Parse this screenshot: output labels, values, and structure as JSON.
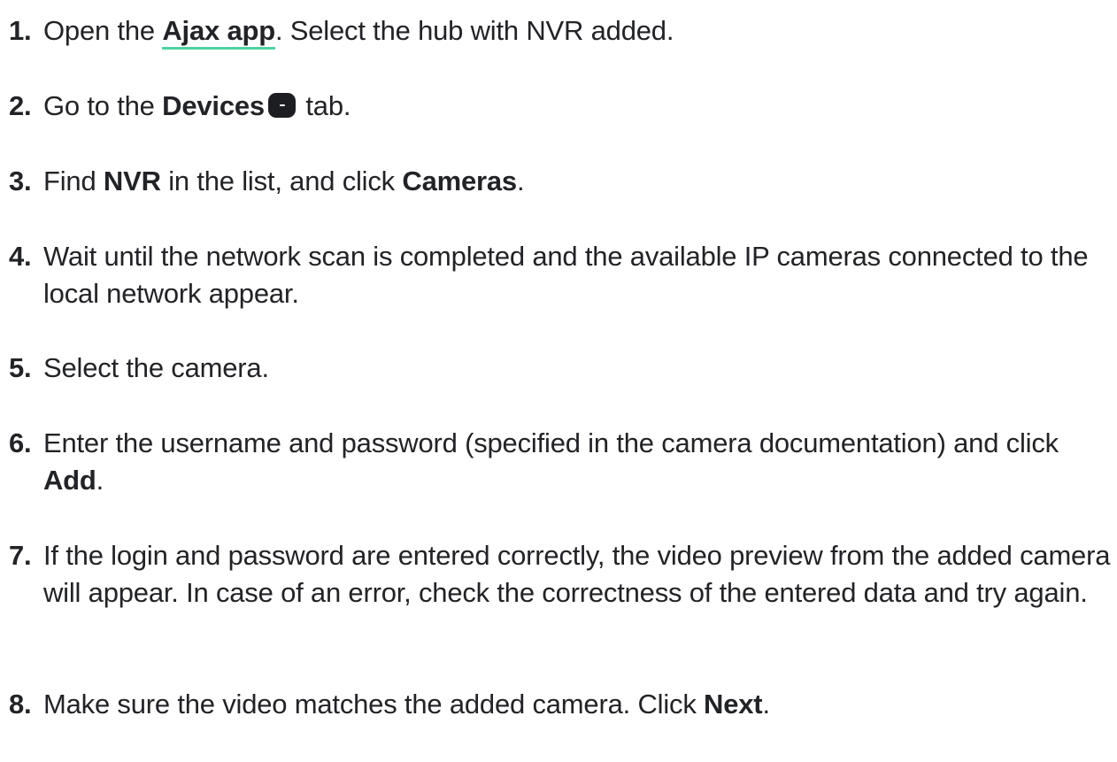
{
  "steps": [
    {
      "num": "1.",
      "pre": "Open the ",
      "link": "Ajax app",
      "post": ". Select the hub with NVR added."
    },
    {
      "num": "2.",
      "pre": "Go to the ",
      "bold": "Devices",
      "icon": "devices-tab-icon",
      "post": " tab."
    },
    {
      "num": "3.",
      "pre": "Find ",
      "bold1": "NVR",
      "mid": " in the list, and click ",
      "bold2": "Cameras",
      "post": "."
    },
    {
      "num": "4.",
      "text": "Wait until the network scan is completed and the available IP cameras connected to the local network appear."
    },
    {
      "num": "5.",
      "text": "Select the camera."
    },
    {
      "num": "6.",
      "pre": "Enter the username and password (specified in the camera documentation) and click ",
      "bold": "Add",
      "post": "."
    },
    {
      "num": "7.",
      "text": "If the login and password are entered correctly, the video preview from the added camera will appear. In case of an error, check the correctness of the entered data and try again."
    },
    {
      "num": "8.",
      "pre": "Make sure the video matches the added camera. Click ",
      "bold": "Next",
      "post": "."
    }
  ],
  "colors": {
    "text": "#222326",
    "link_underline": "#4fd3a0",
    "icon_bg": "#1d1e21"
  }
}
